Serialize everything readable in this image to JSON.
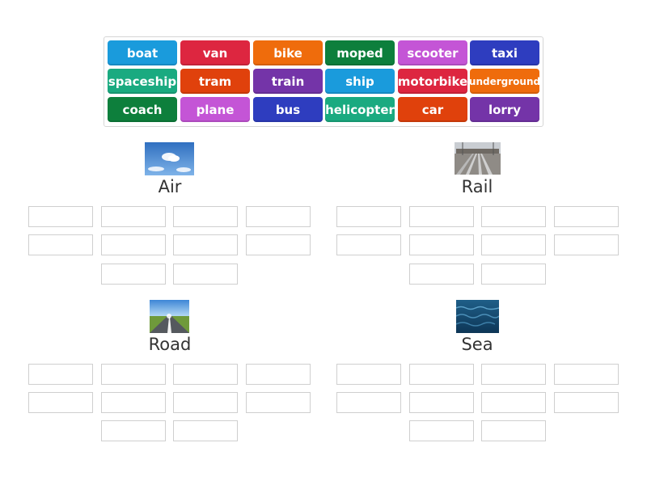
{
  "tiles": [
    {
      "label": "boat",
      "color": "#1a9bdc"
    },
    {
      "label": "van",
      "color": "#dd2640"
    },
    {
      "label": "bike",
      "color": "#ef6c0c"
    },
    {
      "label": "moped",
      "color": "#0d7f3c"
    },
    {
      "label": "scooter",
      "color": "#c455d6"
    },
    {
      "label": "taxi",
      "color": "#2e3dbf"
    },
    {
      "label": "spaceship",
      "color": "#1aaa80"
    },
    {
      "label": "tram",
      "color": "#e0410c"
    },
    {
      "label": "train",
      "color": "#7434a8"
    },
    {
      "label": "ship",
      "color": "#1a9bdc"
    },
    {
      "label": "motorbike",
      "color": "#dd2640"
    },
    {
      "label": "underground",
      "color": "#ef6c0c"
    },
    {
      "label": "coach",
      "color": "#0d7f3c"
    },
    {
      "label": "plane",
      "color": "#c455d6"
    },
    {
      "label": "bus",
      "color": "#2e3dbf"
    },
    {
      "label": "helicopter",
      "color": "#1aaa80"
    },
    {
      "label": "car",
      "color": "#e0410c"
    },
    {
      "label": "lorry",
      "color": "#7434a8"
    }
  ],
  "groups": [
    {
      "title": "Air",
      "image": "sky-image"
    },
    {
      "title": "Rail",
      "image": "railway-image"
    },
    {
      "title": "Road",
      "image": "road-image"
    },
    {
      "title": "Sea",
      "image": "sea-image"
    }
  ]
}
